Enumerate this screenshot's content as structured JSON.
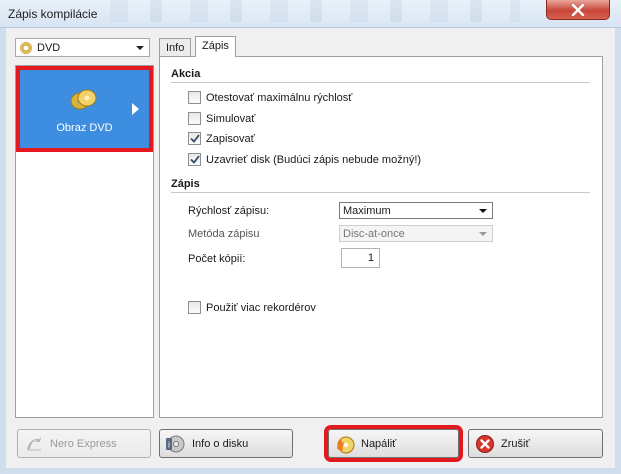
{
  "window": {
    "title": "Zápis kompilácie"
  },
  "device": {
    "selected": "DVD"
  },
  "sidebar": {
    "items": [
      {
        "label": "Obraz DVD",
        "icon": "dvd-image-icon"
      }
    ]
  },
  "tabs": [
    {
      "label": "Info"
    },
    {
      "label": "Zápis"
    }
  ],
  "akcia": {
    "title": "Akcia",
    "options": [
      {
        "label": "Otestovať maximálnu rýchlosť",
        "checked": false
      },
      {
        "label": "Simulovať",
        "checked": false
      },
      {
        "label": "Zapisovať",
        "checked": true
      },
      {
        "label": "Uzavrieť disk (Budúci zápis nebude možný!)",
        "checked": true
      }
    ]
  },
  "zapis": {
    "title": "Zápis",
    "speed_label": "Rýchlosť zápisu:",
    "speed_value": "Maximum",
    "method_label": "Metóda zápisu",
    "method_value": "Disc-at-once",
    "copies_label": "Počet kópií:",
    "copies_value": "1",
    "multi_label": "Použiť viac rekordérov",
    "multi_checked": false
  },
  "buttons": {
    "nero_express": "Nero Express",
    "disc_info": "Info o disku",
    "burn": "Napáliť",
    "cancel": "Zrušiť"
  },
  "colors": {
    "selection": "#3d8ee0",
    "highlight": "#e3191f"
  }
}
